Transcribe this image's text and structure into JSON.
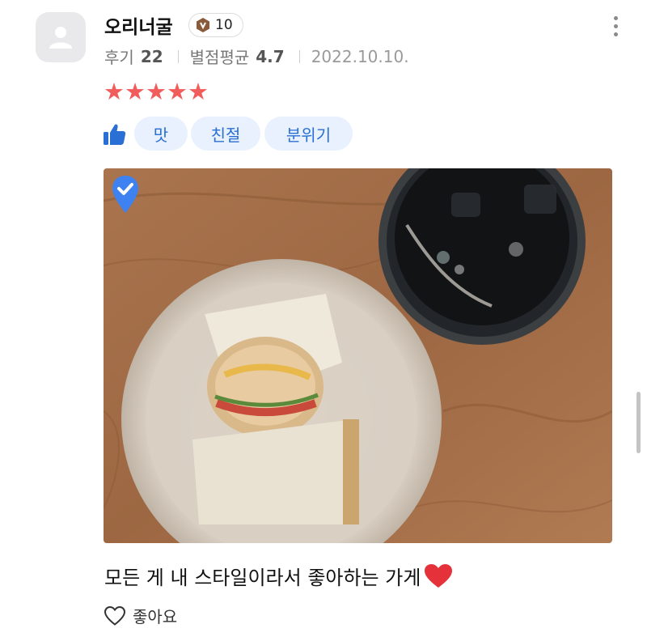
{
  "user": {
    "name": "오리너굴",
    "badge_count": "10",
    "review_label": "후기",
    "review_count": "22",
    "rating_label": "별점평균",
    "rating_avg": "4.7",
    "date": "2022.10.10."
  },
  "stars": {
    "glyphs": "★★★★★",
    "value": 5,
    "max": 5,
    "color": "#f15c5c"
  },
  "tags": [
    "맛",
    "친절",
    "분위기"
  ],
  "review_text": "모든 게 내 스타일이라서 좋아하는 가게",
  "like_label": "좋아요",
  "colors": {
    "accent": "#2a6fd3",
    "chip_bg": "#e8f1fd",
    "star": "#f15c5c"
  }
}
